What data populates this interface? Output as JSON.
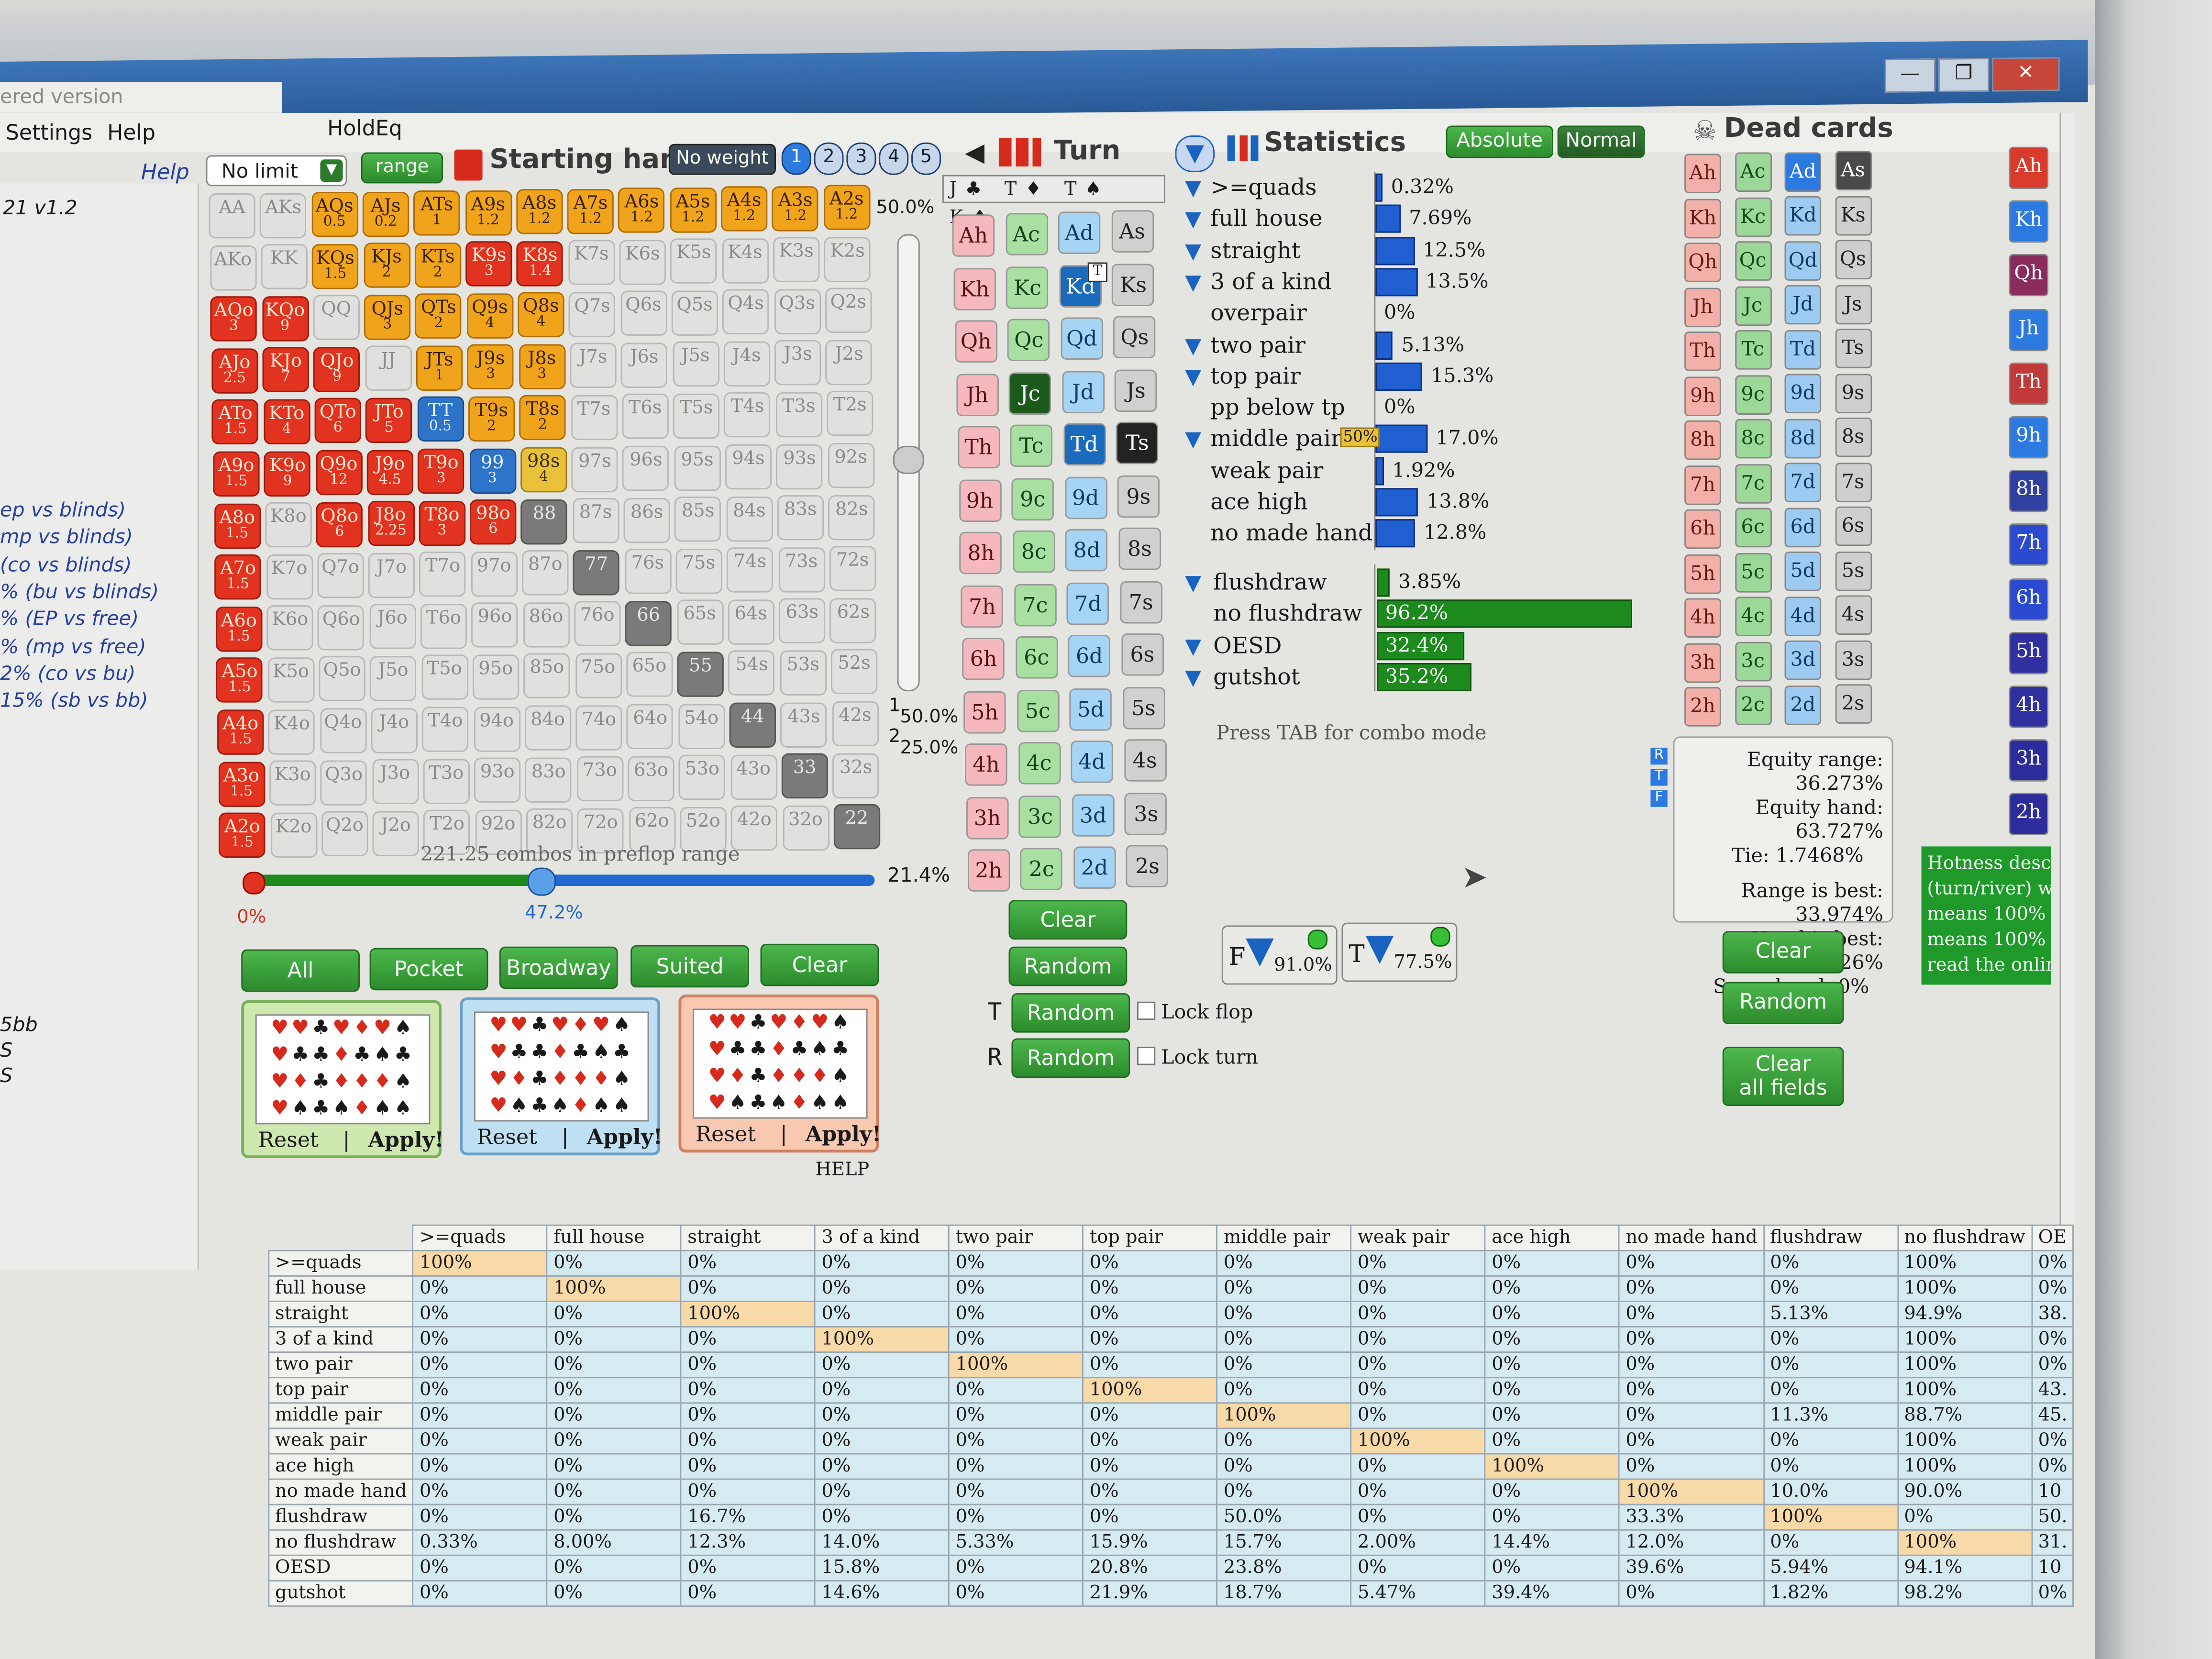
{
  "window": {
    "title_fragment": "ered version",
    "controls": [
      "—",
      "❐",
      "✕"
    ]
  },
  "menu": {
    "settings": "Settings",
    "help": "Help",
    "app_name": "HoldEq"
  },
  "sidebar": {
    "help_link": "Help",
    "version": "21 v1.2",
    "items": [
      "ep vs blinds)",
      "mp vs blinds)",
      "(co vs blinds)",
      "% (bu vs blinds)",
      "% (EP vs free)",
      "% (mp vs free)",
      "2% (co vs bu)",
      "15% (sb vs bb)"
    ],
    "bottom_items": [
      "5bb",
      "S",
      "S"
    ]
  },
  "range_panel": {
    "limit_select": "No limit",
    "range_label": "range",
    "title": "Starting hand",
    "weight_button": "No weight",
    "tabs": [
      "1",
      "2",
      "3",
      "4",
      "5"
    ],
    "slider_top": "50.0%",
    "slider_mid1": "50.0%",
    "slider_mid2": "25.0%",
    "slider_mid_marks": [
      "1",
      "2"
    ],
    "combos_text": "221.25 combos in preflop range",
    "percent_right": "21.4%",
    "percent_left": "0%",
    "percent_mid": "47.2%",
    "quick_buttons": [
      "All",
      "Pocket",
      "Broadway",
      "Suited",
      "Clear"
    ],
    "suit_panel_reset": "Reset",
    "suit_panel_sep": "|",
    "suit_panel_apply": "Apply!",
    "help_text": "HELP",
    "rows": [
      [
        [
          "AA",
          ""
        ],
        [
          "AKs",
          ""
        ],
        [
          "AQs",
          "0.5"
        ],
        [
          "AJs",
          "0.2"
        ],
        [
          "ATs",
          "1"
        ],
        [
          "A9s",
          "1.2"
        ],
        [
          "A8s",
          "1.2"
        ],
        [
          "A7s",
          "1.2"
        ],
        [
          "A6s",
          "1.2"
        ],
        [
          "A5s",
          "1.2"
        ],
        [
          "A4s",
          "1.2"
        ],
        [
          "A3s",
          "1.2"
        ],
        [
          "A2s",
          "1.2"
        ]
      ],
      [
        [
          "AKo",
          ""
        ],
        [
          "KK",
          ""
        ],
        [
          "KQs",
          "1.5"
        ],
        [
          "KJs",
          "2"
        ],
        [
          "KTs",
          "2"
        ],
        [
          "K9s",
          "3"
        ],
        [
          "K8s",
          "1.4"
        ],
        [
          "K7s",
          ""
        ],
        [
          "K6s",
          ""
        ],
        [
          "K5s",
          ""
        ],
        [
          "K4s",
          ""
        ],
        [
          "K3s",
          ""
        ],
        [
          "K2s",
          ""
        ]
      ],
      [
        [
          "AQo",
          "3"
        ],
        [
          "KQo",
          "9"
        ],
        [
          "QQ",
          ""
        ],
        [
          "QJs",
          "3"
        ],
        [
          "QTs",
          "2"
        ],
        [
          "Q9s",
          "4"
        ],
        [
          "Q8s",
          "4"
        ],
        [
          "Q7s",
          ""
        ],
        [
          "Q6s",
          ""
        ],
        [
          "Q5s",
          ""
        ],
        [
          "Q4s",
          ""
        ],
        [
          "Q3s",
          ""
        ],
        [
          "Q2s",
          ""
        ]
      ],
      [
        [
          "AJo",
          "2.5"
        ],
        [
          "KJo",
          "7"
        ],
        [
          "QJo",
          "9"
        ],
        [
          "JJ",
          ""
        ],
        [
          "JTs",
          "1"
        ],
        [
          "J9s",
          "3"
        ],
        [
          "J8s",
          "3"
        ],
        [
          "J7s",
          ""
        ],
        [
          "J6s",
          ""
        ],
        [
          "J5s",
          ""
        ],
        [
          "J4s",
          ""
        ],
        [
          "J3s",
          ""
        ],
        [
          "J2s",
          ""
        ]
      ],
      [
        [
          "ATo",
          "1.5"
        ],
        [
          "KTo",
          "4"
        ],
        [
          "QTo",
          "6"
        ],
        [
          "JTo",
          "5"
        ],
        [
          "TT",
          "0.5"
        ],
        [
          "T9s",
          "2"
        ],
        [
          "T8s",
          "2"
        ],
        [
          "T7s",
          ""
        ],
        [
          "T6s",
          ""
        ],
        [
          "T5s",
          ""
        ],
        [
          "T4s",
          ""
        ],
        [
          "T3s",
          ""
        ],
        [
          "T2s",
          ""
        ]
      ],
      [
        [
          "A9o",
          "1.5"
        ],
        [
          "K9o",
          "9"
        ],
        [
          "Q9o",
          "12"
        ],
        [
          "J9o",
          "4.5"
        ],
        [
          "T9o",
          "3"
        ],
        [
          "99",
          "3"
        ],
        [
          "98s",
          "4"
        ],
        [
          "97s",
          ""
        ],
        [
          "96s",
          ""
        ],
        [
          "95s",
          ""
        ],
        [
          "94s",
          ""
        ],
        [
          "93s",
          ""
        ],
        [
          "92s",
          ""
        ]
      ],
      [
        [
          "A8o",
          "1.5"
        ],
        [
          "K8o",
          ""
        ],
        [
          "Q8o",
          "6"
        ],
        [
          "J8o",
          "2.25"
        ],
        [
          "T8o",
          "3"
        ],
        [
          "98o",
          "6"
        ],
        [
          "88",
          ""
        ],
        [
          "87s",
          ""
        ],
        [
          "86s",
          ""
        ],
        [
          "85s",
          ""
        ],
        [
          "84s",
          ""
        ],
        [
          "83s",
          ""
        ],
        [
          "82s",
          ""
        ]
      ],
      [
        [
          "A7o",
          "1.5"
        ],
        [
          "K7o",
          ""
        ],
        [
          "Q7o",
          ""
        ],
        [
          "J7o",
          ""
        ],
        [
          "T7o",
          ""
        ],
        [
          "97o",
          ""
        ],
        [
          "87o",
          ""
        ],
        [
          "77",
          ""
        ],
        [
          "76s",
          ""
        ],
        [
          "75s",
          ""
        ],
        [
          "74s",
          ""
        ],
        [
          "73s",
          ""
        ],
        [
          "72s",
          ""
        ]
      ],
      [
        [
          "A6o",
          "1.5"
        ],
        [
          "K6o",
          ""
        ],
        [
          "Q6o",
          ""
        ],
        [
          "J6o",
          ""
        ],
        [
          "T6o",
          ""
        ],
        [
          "96o",
          ""
        ],
        [
          "86o",
          ""
        ],
        [
          "76o",
          ""
        ],
        [
          "66",
          ""
        ],
        [
          "65s",
          ""
        ],
        [
          "64s",
          ""
        ],
        [
          "63s",
          ""
        ],
        [
          "62s",
          ""
        ]
      ],
      [
        [
          "A5o",
          "1.5"
        ],
        [
          "K5o",
          ""
        ],
        [
          "Q5o",
          ""
        ],
        [
          "J5o",
          ""
        ],
        [
          "T5o",
          ""
        ],
        [
          "95o",
          ""
        ],
        [
          "85o",
          ""
        ],
        [
          "75o",
          ""
        ],
        [
          "65o",
          ""
        ],
        [
          "55",
          ""
        ],
        [
          "54s",
          ""
        ],
        [
          "53s",
          ""
        ],
        [
          "52s",
          ""
        ]
      ],
      [
        [
          "A4o",
          "1.5"
        ],
        [
          "K4o",
          ""
        ],
        [
          "Q4o",
          ""
        ],
        [
          "J4o",
          ""
        ],
        [
          "T4o",
          ""
        ],
        [
          "94o",
          ""
        ],
        [
          "84o",
          ""
        ],
        [
          "74o",
          ""
        ],
        [
          "64o",
          ""
        ],
        [
          "54o",
          ""
        ],
        [
          "44",
          ""
        ],
        [
          "43s",
          ""
        ],
        [
          "42s",
          ""
        ]
      ],
      [
        [
          "A3o",
          "1.5"
        ],
        [
          "K3o",
          ""
        ],
        [
          "Q3o",
          ""
        ],
        [
          "J3o",
          ""
        ],
        [
          "T3o",
          ""
        ],
        [
          "93o",
          ""
        ],
        [
          "83o",
          ""
        ],
        [
          "73o",
          ""
        ],
        [
          "63o",
          ""
        ],
        [
          "53o",
          ""
        ],
        [
          "43o",
          ""
        ],
        [
          "33",
          ""
        ],
        [
          "32s",
          ""
        ]
      ],
      [
        [
          "A2o",
          "1.5"
        ],
        [
          "K2o",
          ""
        ],
        [
          "Q2o",
          ""
        ],
        [
          "J2o",
          ""
        ],
        [
          "T2o",
          ""
        ],
        [
          "92o",
          ""
        ],
        [
          "82o",
          ""
        ],
        [
          "72o",
          ""
        ],
        [
          "62o",
          ""
        ],
        [
          "52o",
          ""
        ],
        [
          "42o",
          ""
        ],
        [
          "32o",
          ""
        ],
        [
          "22",
          ""
        ]
      ]
    ]
  },
  "board_panel": {
    "title": "Turn",
    "buttons": {
      "clear": "Clear",
      "random": "Random",
      "flop_random": "Random",
      "turn_random": "Random"
    },
    "lock_flop": "Lock flop",
    "lock_turn": "Lock turn",
    "flop_marker": "T",
    "river_marker": "R",
    "selected_card_marker": "T",
    "cards": [
      [
        "Ah",
        "Ac",
        "Ad",
        "As"
      ],
      [
        "Kh",
        "Kc",
        "Kd",
        "Ks"
      ],
      [
        "Qh",
        "Qc",
        "Qd",
        "Qs"
      ],
      [
        "Jh",
        "Jc",
        "Jd",
        "Js"
      ],
      [
        "Th",
        "Tc",
        "Td",
        "Ts"
      ],
      [
        "9h",
        "9c",
        "9d",
        "9s"
      ],
      [
        "8h",
        "8c",
        "8d",
        "8s"
      ],
      [
        "7h",
        "7c",
        "7d",
        "7s"
      ],
      [
        "6h",
        "6c",
        "6d",
        "6s"
      ],
      [
        "5h",
        "5c",
        "5d",
        "5s"
      ],
      [
        "4h",
        "4c",
        "4d",
        "4s"
      ],
      [
        "3h",
        "3c",
        "3d",
        "3s"
      ],
      [
        "2h",
        "2c",
        "2d",
        "2s"
      ]
    ]
  },
  "statistics": {
    "title": "Statistics",
    "mode_absolute": "Absolute",
    "mode_normal": "Normal",
    "rows": [
      {
        "label": ">=quads",
        "value": "0.32%",
        "pct": 0.32,
        "filter": true
      },
      {
        "label": "full house",
        "value": "7.69%",
        "pct": 7.69,
        "filter": true
      },
      {
        "label": "straight",
        "value": "12.5%",
        "pct": 12.5,
        "filter": true
      },
      {
        "label": "3 of a kind",
        "value": "13.5%",
        "pct": 13.5,
        "filter": true
      },
      {
        "label": "overpair",
        "value": "0%",
        "pct": 0,
        "filter": false
      },
      {
        "label": "two pair",
        "value": "5.13%",
        "pct": 5.13,
        "filter": true
      },
      {
        "label": "top pair",
        "value": "15.3%",
        "pct": 15.3,
        "filter": true
      },
      {
        "label": "pp below tp",
        "value": "0%",
        "pct": 0,
        "filter": false
      },
      {
        "label": "middle pair",
        "value": "17.0%",
        "pct": 17.0,
        "filter": true,
        "badge": "50%"
      },
      {
        "label": "weak pair",
        "value": "1.92%",
        "pct": 1.92,
        "filter": false
      },
      {
        "label": "ace high",
        "value": "13.8%",
        "pct": 13.8,
        "filter": false
      },
      {
        "label": "no made hand",
        "value": "12.8%",
        "pct": 12.8,
        "filter": false
      }
    ],
    "draw_rows": [
      {
        "label": "flushdraw",
        "value": "3.85%",
        "pct": 3.85,
        "filter": true
      },
      {
        "label": "no flushdraw",
        "value": "96.2%",
        "pct": 96.2,
        "filter": false
      },
      {
        "label": "OESD",
        "value": "32.4%",
        "pct": 32.4,
        "filter": true
      },
      {
        "label": "gutshot",
        "value": "35.2%",
        "pct": 35.2,
        "filter": true
      }
    ],
    "tab_hint": "Press TAB for combo mode",
    "filter_f": {
      "letter": "F",
      "value": "91.0%"
    },
    "filter_t": {
      "letter": "T",
      "value": "77.5%"
    }
  },
  "dead_cards": {
    "title": "Dead cards",
    "cards": [
      [
        "Ah",
        "Ac",
        "Ad",
        "As"
      ],
      [
        "Kh",
        "Kc",
        "Kd",
        "Ks"
      ],
      [
        "Qh",
        "Qc",
        "Qd",
        "Qs"
      ],
      [
        "Jh",
        "Jc",
        "Jd",
        "Js"
      ],
      [
        "Th",
        "Tc",
        "Td",
        "Ts"
      ],
      [
        "9h",
        "9c",
        "9d",
        "9s"
      ],
      [
        "8h",
        "8c",
        "8d",
        "8s"
      ],
      [
        "7h",
        "7c",
        "7d",
        "7s"
      ],
      [
        "6h",
        "6c",
        "6d",
        "6s"
      ],
      [
        "5h",
        "5c",
        "5d",
        "5s"
      ],
      [
        "4h",
        "4c",
        "4d",
        "4s"
      ],
      [
        "3h",
        "3c",
        "3d",
        "3s"
      ],
      [
        "2h",
        "2c",
        "2d",
        "2s"
      ]
    ],
    "side_cards": [
      "Ah",
      "Kh",
      "Qh",
      "Jh",
      "Th",
      "9h",
      "8h",
      "7h",
      "6h",
      "5h",
      "4h",
      "3h",
      "2h"
    ],
    "rtf": [
      "R",
      "T",
      "F"
    ]
  },
  "equity": {
    "range": "Equity range: 36.273%",
    "hand": "Equity hand: 63.727%",
    "tie": "Tie: 1.7468%",
    "range_best": "Range is best: 33.974%",
    "hand_best": "Hand is best: 66.026%",
    "same": "Same hand: 0%",
    "clear": "Clear",
    "random": "Random",
    "clear_all_1": "Clear",
    "clear_all_2": "all fields"
  },
  "hotness": [
    "Hotness desc",
    "(turn/river) w",
    "means 100% c",
    "means 100% c",
    "read the onlin"
  ],
  "matrix": {
    "columns": [
      ">=quads",
      "full house",
      "straight",
      "3 of a kind",
      "two pair",
      "top pair",
      "middle pair",
      "weak pair",
      "ace high",
      "no made hand",
      "flushdraw",
      "no flushdraw",
      "OE"
    ],
    "rows": [
      {
        "label": ">=quads",
        "cells": [
          "100%",
          "0%",
          "0%",
          "0%",
          "0%",
          "0%",
          "0%",
          "0%",
          "0%",
          "0%",
          "0%",
          "100%",
          "0%"
        ]
      },
      {
        "label": "full house",
        "cells": [
          "0%",
          "100%",
          "0%",
          "0%",
          "0%",
          "0%",
          "0%",
          "0%",
          "0%",
          "0%",
          "0%",
          "100%",
          "0%"
        ]
      },
      {
        "label": "straight",
        "cells": [
          "0%",
          "0%",
          "100%",
          "0%",
          "0%",
          "0%",
          "0%",
          "0%",
          "0%",
          "0%",
          "5.13%",
          "94.9%",
          "38."
        ]
      },
      {
        "label": "3 of a kind",
        "cells": [
          "0%",
          "0%",
          "0%",
          "100%",
          "0%",
          "0%",
          "0%",
          "0%",
          "0%",
          "0%",
          "0%",
          "100%",
          "0%"
        ]
      },
      {
        "label": "two pair",
        "cells": [
          "0%",
          "0%",
          "0%",
          "0%",
          "100%",
          "0%",
          "0%",
          "0%",
          "0%",
          "0%",
          "0%",
          "100%",
          "0%"
        ]
      },
      {
        "label": "top pair",
        "cells": [
          "0%",
          "0%",
          "0%",
          "0%",
          "0%",
          "100%",
          "0%",
          "0%",
          "0%",
          "0%",
          "0%",
          "100%",
          "43."
        ]
      },
      {
        "label": "middle pair",
        "cells": [
          "0%",
          "0%",
          "0%",
          "0%",
          "0%",
          "0%",
          "100%",
          "0%",
          "0%",
          "0%",
          "11.3%",
          "88.7%",
          "45."
        ]
      },
      {
        "label": "weak pair",
        "cells": [
          "0%",
          "0%",
          "0%",
          "0%",
          "0%",
          "0%",
          "0%",
          "100%",
          "0%",
          "0%",
          "0%",
          "100%",
          "0%"
        ]
      },
      {
        "label": "ace high",
        "cells": [
          "0%",
          "0%",
          "0%",
          "0%",
          "0%",
          "0%",
          "0%",
          "0%",
          "100%",
          "0%",
          "0%",
          "100%",
          "0%"
        ]
      },
      {
        "label": "no made hand",
        "cells": [
          "0%",
          "0%",
          "0%",
          "0%",
          "0%",
          "0%",
          "0%",
          "0%",
          "0%",
          "100%",
          "10.0%",
          "90.0%",
          "10"
        ]
      },
      {
        "label": "flushdraw",
        "cells": [
          "0%",
          "0%",
          "16.7%",
          "0%",
          "0%",
          "0%",
          "50.0%",
          "0%",
          "0%",
          "33.3%",
          "100%",
          "0%",
          "50."
        ]
      },
      {
        "label": "no flushdraw",
        "cells": [
          "0.33%",
          "8.00%",
          "12.3%",
          "14.0%",
          "5.33%",
          "15.9%",
          "15.7%",
          "2.00%",
          "14.4%",
          "12.0%",
          "0%",
          "100%",
          "31."
        ]
      },
      {
        "label": "OESD",
        "cells": [
          "0%",
          "0%",
          "0%",
          "15.8%",
          "0%",
          "20.8%",
          "23.8%",
          "0%",
          "0%",
          "39.6%",
          "5.94%",
          "94.1%",
          "10"
        ]
      },
      {
        "label": "gutshot",
        "cells": [
          "0%",
          "0%",
          "0%",
          "14.6%",
          "0%",
          "21.9%",
          "18.7%",
          "5.47%",
          "39.4%",
          "0%",
          "1.82%",
          "98.2%",
          "0%"
        ]
      }
    ]
  }
}
